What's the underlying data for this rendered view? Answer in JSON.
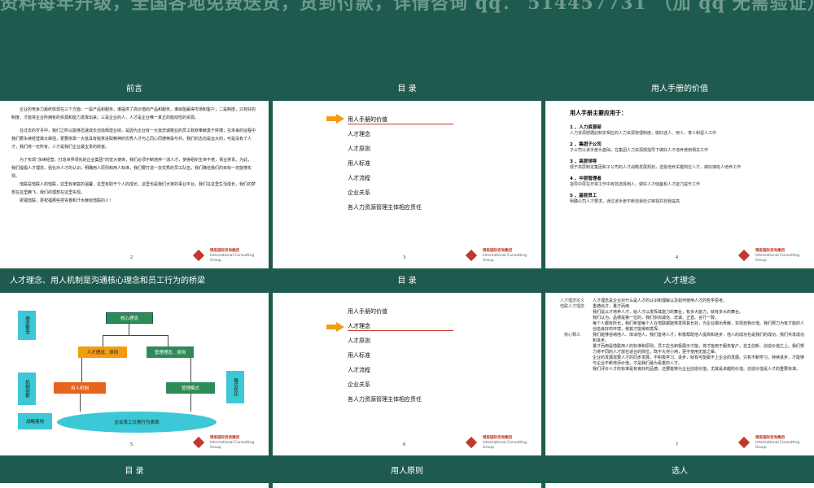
{
  "banner": "资料每年升级，全国各地免费送货，货到付款，详情咨询 qq： 514457731 （加 qq 无需验证）",
  "logo": {
    "cn": "锦思国际咨询集团",
    "en": "International Consulting Group"
  },
  "slides": {
    "s1": {
      "title": "前言",
      "page": "2",
      "paragraphs": [
        "企业的竞争力最终体现在三个方面：一是产品和服务，谁提供了高价值的产品和服务，谁就能赢得市场和客户；二是制度，只有好的制度，才能将企业所拥有的资源和能力发挥出来；三是企业的人，人才是企业唯一真正的能动性的资源。",
        "在过去的岁月中，我们之所以能够迅速成长创造辉煌业绩，是因为企业有一大批忠诚敬业的员工默默奉献勇于拼搏；在未来的征程中我们要永续经营做大做强，更要依靠一大批具有锐意进取精神的优秀人才与之同心同德荣辱与共。我们的志向是远大的，可是没有了人才，我们将一无所有。人才是我们企业最宝贵的财富。",
        "为了实现“永续经营，打造世界领先的企业集团”的宏大使命，我们必须不断培养一流人才，使得组织生命不老，事业常青。为此，我们提倡人才理念，强化对人才的认识，明确用人原则和用人标准，我们要打造一支优秀的员工队伍，我们确信我们的目标一定能够实现。",
        "惜联是惜联人的惜联，这里有家庭的温馨，这里有助于个人的成长，这里也是我们大家的事业平台。我们在这里生活成长，我们的梦想在这里腾飞，我们的理想在这里实现。",
        "祝福惜联，更祝福那些把青春和汗水献给惜联的人！"
      ]
    },
    "s2": {
      "title": "目 录",
      "page": "3",
      "items": [
        "用人手册的价值",
        "人才理念",
        "人才原则",
        "用人标准",
        "人才流程",
        "企业关系",
        "各人力资源管理主体相应责任"
      ]
    },
    "s3": {
      "title": "用人手册的价值",
      "page": "4",
      "heading": "用人手册主要应用于：",
      "items": [
        {
          "h": "1 、人力资源部",
          "t": "人力资源部据此制定相应的人力资源管理制度，做好选人、用人、育人和留人工作"
        },
        {
          "h": "2 、集团子公司",
          "t": "子公司以该手册为基础，在集团人力资源部指导下做好人才培养使用相关工作"
        },
        {
          "h": "3 、高层领导",
          "t": "便于高层制定集团和子公司的人才战略发展规划，选拔培养关键岗位人才，做好接班人培养工作"
        },
        {
          "h": "4 、中层管理者",
          "t": "指导中层在日常工作中有效选择用人，做好人才储备和人才能力提升工作"
        },
        {
          "h": "5 、基层员工",
          "t": "明确公司人才要求，通过该手册不断自我检讨审视并自我提高"
        }
      ]
    },
    "s4": {
      "title": "人才理念、用人机制是沟通核心理念和员工行为的桥梁",
      "page": "5",
      "labels": {
        "core": "核心理念",
        "talent": "人才理念、原则",
        "mgmt": "管理理念、原则",
        "mech": "用人机制",
        "mode": "管理模式",
        "daily": "企业员工日常行为表现",
        "side1": "理念整合",
        "side2": "机制创新",
        "side3": "战略落地",
        "side4": "模式优化"
      }
    },
    "s5": {
      "title": "目 录",
      "page": "6",
      "items": [
        "用人手册的价值",
        "人才理念",
        "人才原则",
        "用人标准",
        "人才流程",
        "企业关系",
        "各人力资源管理主体相应责任"
      ]
    },
    "s6": {
      "title": "人才理念",
      "page": "7",
      "rows": [
        {
          "k": "人才理念定义",
          "v": "人才理念是企业对什么是人才的认识和理解以及如何使用人才的哲学思考。"
        },
        {
          "k": "惜联人才理念",
          "v": "重德尚才，量才而用"
        },
        {
          "k": "",
          "v": "我们是以才培养人才，给人才以发挥其能力的舞台，有多大能力，就有多大的舞台。"
        },
        {
          "k": "",
          "v": "我们认为，品德是第一位的，我们崇尚诚信、忠诚、正直、言行一致。"
        },
        {
          "k": "",
          "v": "每个人都有所长，我们希望每个人在惜联都能够发挥其长处，为企业做出贡献，实现自我价值。我们努力为有才能的人创造良好的环境，使其才能得到发挥。"
        },
        {
          "k": "核心释义",
          "v": "我们能够容纳他人、体谅他人，我们善待人才，积极帮助他人提高和进步，他人的成功也是我们的成功，我们共享成功和进步。"
        },
        {
          "k": "",
          "v": "量才而用是惜联用人的标准和原则，员工应当积极展示才能，将才能用于服务客户，自主创新、创造价值之上。我们努力将不同的人才放在适合的岗位，既不大材小用，更不使用无能之辈。"
        },
        {
          "k": "",
          "v": "企业的发展需要人才的同步发展，不积极学习、进步，就有可能跟不上企业的发展。只有不断学习，持续进步，才能够与企业不断增添价值，才是我们最为看重的人才。"
        },
        {
          "k": "",
          "v": "我们评价人才的标准是有良好的品德，还要能够为企业创造价值，尤其是卓越的价值。创造价值是人才的重要标准。"
        }
      ]
    },
    "s7": {
      "title": "目 录"
    },
    "s8": {
      "title": "用人原则"
    },
    "s9": {
      "title": "选人"
    }
  },
  "colors": {
    "header": "#1e5a4e",
    "accent": "#f39c12",
    "red": "#c0392b"
  }
}
